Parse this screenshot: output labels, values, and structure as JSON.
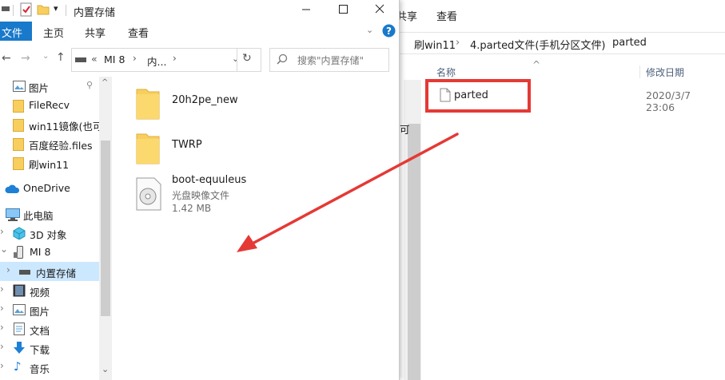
{
  "back_window": {
    "ribbon_tabs": [
      "共享",
      "查看"
    ],
    "breadcrumbs": [
      "刷win11",
      "4.parted文件(手机分区文件)",
      "parted"
    ],
    "columns": {
      "name": "名称",
      "modified": "修改日期"
    },
    "partial_text": "可",
    "file": {
      "name": "parted",
      "modified": "2020/3/7 23:06"
    },
    "highlight_color": "#e53935"
  },
  "front_window": {
    "title": "内置存储",
    "ribbon": {
      "file": "文件",
      "tabs": [
        "主页",
        "共享",
        "查看"
      ]
    },
    "address": {
      "root": "MI 8",
      "current": "内..."
    },
    "search_placeholder": "搜索\"内置存储\"",
    "sidebar": [
      {
        "label": "图片",
        "icon": "pictures-icon"
      },
      {
        "label": "FileRecv",
        "icon": "folder-icon"
      },
      {
        "label": "win11镜像(也可",
        "icon": "folder-icon"
      },
      {
        "label": "百度经验.files",
        "icon": "folder-icon"
      },
      {
        "label": "刷win11",
        "icon": "folder-icon"
      },
      {
        "label": "OneDrive",
        "icon": "onedrive-icon"
      },
      {
        "label": "此电脑",
        "icon": "computer-icon"
      },
      {
        "label": "3D 对象",
        "icon": "3d-objects-icon"
      },
      {
        "label": "MI 8",
        "icon": "phone-icon"
      },
      {
        "label": "内置存储",
        "icon": "drive-icon"
      },
      {
        "label": "视频",
        "icon": "videos-icon"
      },
      {
        "label": "图片",
        "icon": "pictures-icon"
      },
      {
        "label": "文档",
        "icon": "documents-icon"
      },
      {
        "label": "下载",
        "icon": "downloads-icon"
      },
      {
        "label": "音乐",
        "icon": "music-icon"
      }
    ],
    "files": [
      {
        "name": "20h2pe_new",
        "type": "folder"
      },
      {
        "name": "TWRP",
        "type": "folder"
      },
      {
        "name": "boot-equuleus",
        "type": "disc-image",
        "kind": "光盘映像文件",
        "size": "1.42 MB"
      }
    ],
    "arrow_color": "#e53935"
  }
}
